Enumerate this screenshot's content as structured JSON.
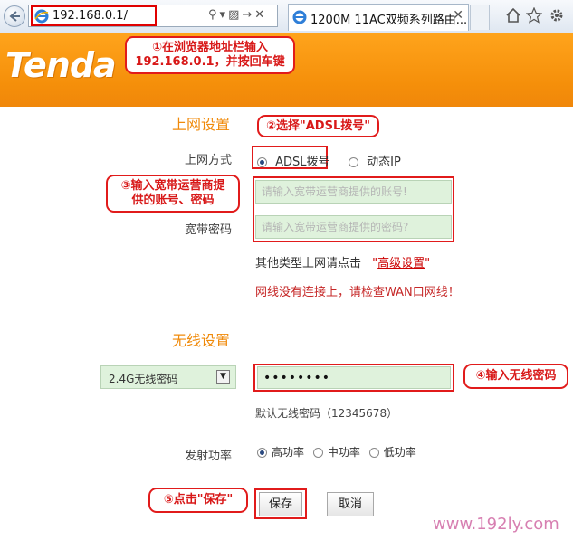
{
  "browser": {
    "address_url": "192.168.0.1/",
    "tab_title": "1200M 11AC双频系列路由...",
    "tab_close": "✕"
  },
  "brand": {
    "logo_text": "Tenda"
  },
  "callouts": {
    "step1": "①在浏览器地址栏输入",
    "step1_line2": "192.168.0.1，并按回车键",
    "step2": "②选择\"ADSL拨号\"",
    "step3_line1": "③输入宽带运营商提",
    "step3_line2": "供的账号、密码",
    "step4": "④输入无线密码",
    "step5": "⑤点击\"保存\""
  },
  "internet": {
    "section_title": "上网设置",
    "mode_label": "上网方式",
    "option_adsl": "ADSL拨号",
    "option_dhcp": "动态IP",
    "selected": "ADSL拨号",
    "account_placeholder": "请输入宽带运营商提供的账号!",
    "password_label": "宽带密码",
    "password_placeholder": "请输入宽带运营商提供的密码?",
    "other_types_text": "其他类型上网请点击",
    "advanced_link": "高级设置",
    "quote_open": "\"",
    "quote_close": "\"",
    "status_text": "网线没有连接上，请检查WAN口网线！"
  },
  "wireless": {
    "section_title": "无线设置",
    "password_select": "2.4G无线密码",
    "password_value": "••••••••",
    "default_hint": "默认无线密码（12345678）",
    "power_label": "发射功率",
    "power_high": "高功率",
    "power_mid": "中功率",
    "power_low": "低功率",
    "power_selected": "高功率"
  },
  "actions": {
    "save": "保存",
    "cancel": "取消"
  },
  "watermark": "www.192ly.com",
  "colors": {
    "accent_orange": "#f58f0a",
    "callout_red": "#e11b1b",
    "input_green": "#dff2dc"
  }
}
